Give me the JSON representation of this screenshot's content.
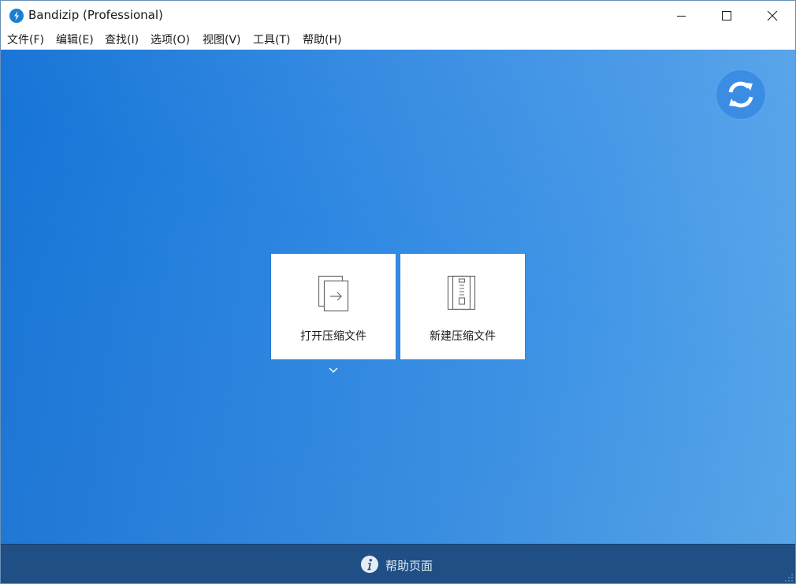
{
  "window": {
    "title": "Bandizip (Professional)"
  },
  "menu": {
    "items": [
      "文件(F)",
      "编辑(E)",
      "查找(I)",
      "选项(O)",
      "视图(V)",
      "工具(T)",
      "帮助(H)"
    ]
  },
  "main": {
    "tiles": [
      {
        "label": "打开压缩文件",
        "icon": "open-archive-icon"
      },
      {
        "label": "新建压缩文件",
        "icon": "new-archive-icon"
      }
    ],
    "update_icon": "refresh-icon"
  },
  "footer": {
    "help_label": "帮助页面",
    "help_icon": "info-icon"
  },
  "colors": {
    "accent_blue": "#1a7fd1",
    "main_gradient_start": "#1573d6",
    "main_gradient_end": "#5aa8ea",
    "footer_bg": "#1f4f85"
  }
}
